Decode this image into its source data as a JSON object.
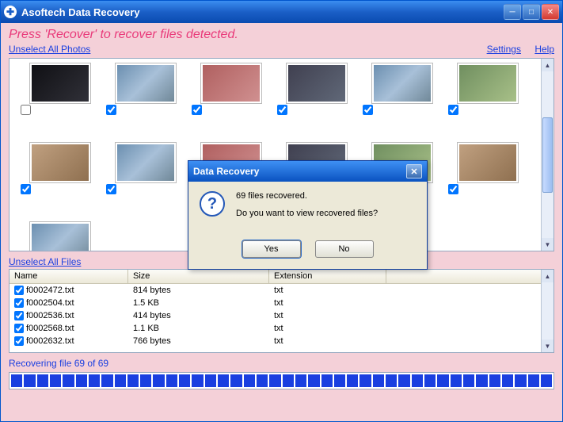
{
  "window": {
    "title": "Asoftech Data Recovery"
  },
  "instruction": "Press 'Recover' to recover files detected.",
  "links": {
    "unselect_photos": "Unselect All Photos",
    "unselect_files": "Unselect All Files",
    "settings": "Settings",
    "help": "Help"
  },
  "photos": [
    {
      "checked": true
    },
    {
      "checked": true
    },
    {
      "checked": true
    },
    {
      "checked": true
    },
    {
      "checked": true
    },
    {
      "checked": true
    },
    {
      "checked": true
    },
    {
      "checked": true
    },
    {
      "checked": true
    },
    {
      "checked": true
    },
    {
      "checked": true
    },
    {
      "checked": true
    },
    {
      "checked": false
    }
  ],
  "file_table": {
    "headers": {
      "name": "Name",
      "size": "Size",
      "ext": "Extension"
    },
    "rows": [
      {
        "name": "f0002472.txt",
        "size": "814 bytes",
        "ext": "txt",
        "checked": true
      },
      {
        "name": "f0002504.txt",
        "size": "1.5 KB",
        "ext": "txt",
        "checked": true
      },
      {
        "name": "f0002536.txt",
        "size": "414 bytes",
        "ext": "txt",
        "checked": true
      },
      {
        "name": "f0002568.txt",
        "size": "1.1 KB",
        "ext": "txt",
        "checked": true
      },
      {
        "name": "f0002632.txt",
        "size": "766 bytes",
        "ext": "txt",
        "checked": true
      }
    ]
  },
  "status": "Recovering file 69 of 69",
  "progress_segments": 42,
  "dialog": {
    "title": "Data Recovery",
    "line1": "69 files recovered.",
    "line2": "Do you want to view recovered files?",
    "yes": "Yes",
    "no": "No"
  }
}
